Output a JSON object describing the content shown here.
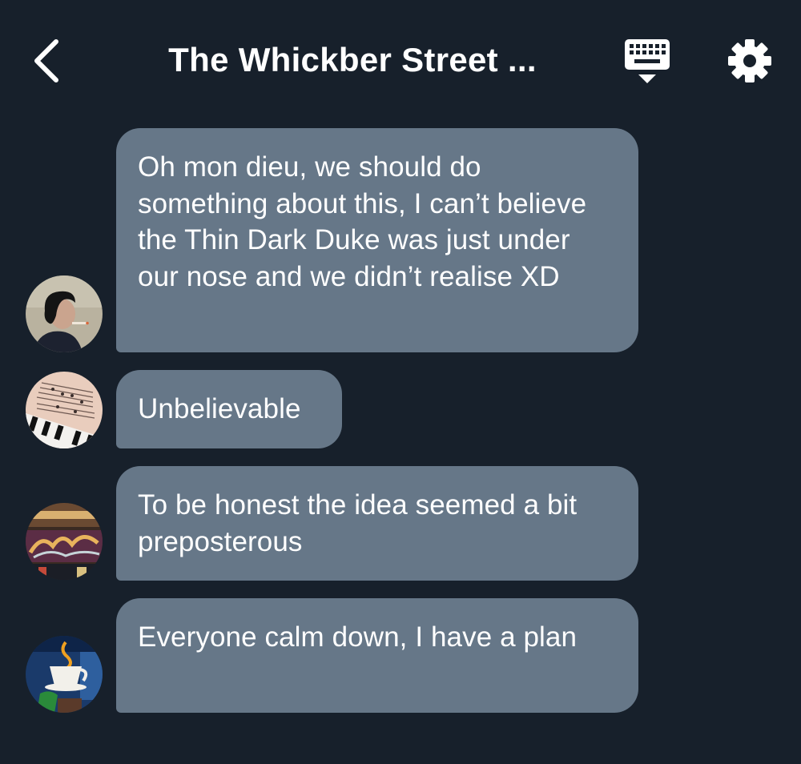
{
  "header": {
    "title": "The Whickber Street ...",
    "back_icon": "chevron-left-icon",
    "keyboard_icon": "keyboard-icon",
    "settings_icon": "gear-icon"
  },
  "colors": {
    "background": "#17202b",
    "bubble": "#667788",
    "text": "#ffffff"
  },
  "messages": [
    {
      "text": "Oh mon dieu, we should do something about this, I can’t believe the Thin Dark Duke was just under our nose and we didn’t realise XD",
      "avatar_icon": "woman-portrait-avatar"
    },
    {
      "text": "Unbelievable",
      "avatar_icon": "sheet-music-piano-avatar"
    },
    {
      "text": "To be honest the idea seemed a bit preposterous",
      "avatar_icon": "magic-shop-sign-avatar"
    },
    {
      "text": "Everyone calm down, I have a plan",
      "avatar_icon": "coffee-cup-sign-avatar"
    }
  ]
}
